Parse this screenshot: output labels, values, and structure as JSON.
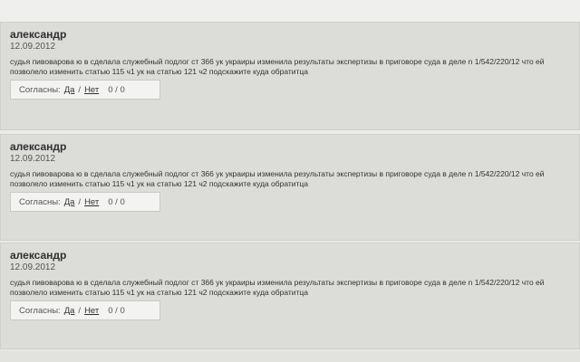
{
  "comments": [
    {
      "author": "александр",
      "date": "12.09.2012",
      "text": "судья пивоварова ю в сделала служебный подлог ст 366 ук украиры изменила результаты экспертизы в приговоре суда в деле n 1/542/220/12 что ей позволело изменить статью 115 ч1 ук на статью 121 ч2 подскажите куда обратитца",
      "vote_label": "Согласны:",
      "yes": "Да",
      "separator": "/",
      "no": "Нет",
      "score": "0 / 0"
    },
    {
      "author": "александр",
      "date": "12.09.2012",
      "text": "судья пивоварова ю в сделала служебный подлог ст 366 ук украиры изменила результаты экспертизы в приговоре суда в деле n 1/542/220/12 что ей позволело изменить статью 115 ч1 ук на статью 121 ч2 подскажите куда обратитца",
      "vote_label": "Согласны:",
      "yes": "Да",
      "separator": "/",
      "no": "Нет",
      "score": "0 / 0"
    },
    {
      "author": "александр",
      "date": "12.09.2012",
      "text": "судья пивоварова ю в сделала служебный подлог ст 366 ук украиры изменила результаты экспертизы в приговоре суда в деле n 1/542/220/12 что ей позволело изменить статью 115 ч1 ук на статью 121 ч2 подскажите куда обратитца",
      "vote_label": "Согласны:",
      "yes": "Да",
      "separator": "/",
      "no": "Нет",
      "score": "0 / 0"
    }
  ]
}
